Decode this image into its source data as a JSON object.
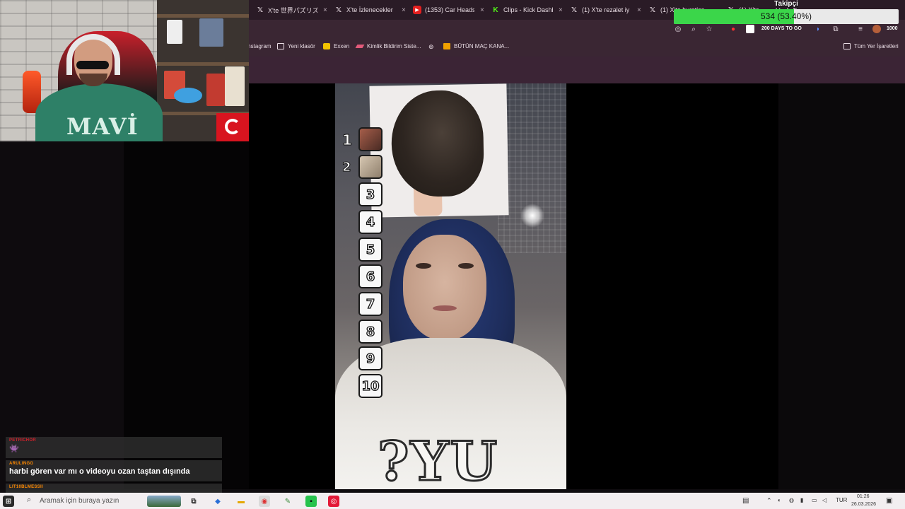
{
  "browser": {
    "tabs": [
      {
        "label": "X'te 世界パズリズム",
        "icon": "x-logo-icon"
      },
      {
        "label": "X'te İzlenecekler",
        "icon": "x-logo-icon"
      },
      {
        "label": "(1353) Car Heads",
        "icon": "youtube-icon"
      },
      {
        "label": "Clips - Kick Dashb",
        "icon": "kick-icon"
      },
      {
        "label": "(1) X'te rezalet iy",
        "icon": "x-logo-icon"
      },
      {
        "label": "(1) X'te burstiss",
        "icon": "x-logo-icon"
      },
      {
        "label": "(1) X'te...",
        "icon": "x-logo-icon"
      }
    ],
    "tab_close_glyph": "×",
    "bookmarks": [
      {
        "label": "Instagram",
        "icon": "instagram-icon"
      },
      {
        "label": "Yeni klasör",
        "icon": "folder-icon"
      },
      {
        "label": "Exxen",
        "icon": "exxen-icon"
      },
      {
        "label": "Kimlik Bildirim Siste...",
        "icon": "pen-icon"
      },
      {
        "label": "",
        "icon": "globe-icon"
      },
      {
        "label": "BÜTÜN MAÇ KANA...",
        "icon": "jp-icon"
      }
    ],
    "all_bookmarks_label": "Tüm Yer İşaretleri",
    "extension_text": "200 DAYS TO GO",
    "extension_count": "1000"
  },
  "video": {
    "ranks": [
      "1",
      "2",
      "3",
      "4",
      "5",
      "6",
      "7",
      "8",
      "9",
      "10"
    ],
    "hoodie_text": "?YU"
  },
  "webcam": {
    "sweater_text": "MAVİ"
  },
  "follower_goal": {
    "title": "Takipçi Hedefi",
    "progress_text": "534 (53.40%)",
    "progress": 0.534
  },
  "chat": [
    {
      "user": "PETRICHOR",
      "text": "👾"
    },
    {
      "user": "ARULINGG",
      "text": "harbi gören var mı o videoyu ozan taştan dışında"
    },
    {
      "user": "LIT10BLMESSII",
      "text": ""
    }
  ],
  "taskbar": {
    "search_placeholder": "Aramak için buraya yazın",
    "language": "TUR",
    "time": "01:26",
    "date": "26.03.2026"
  }
}
